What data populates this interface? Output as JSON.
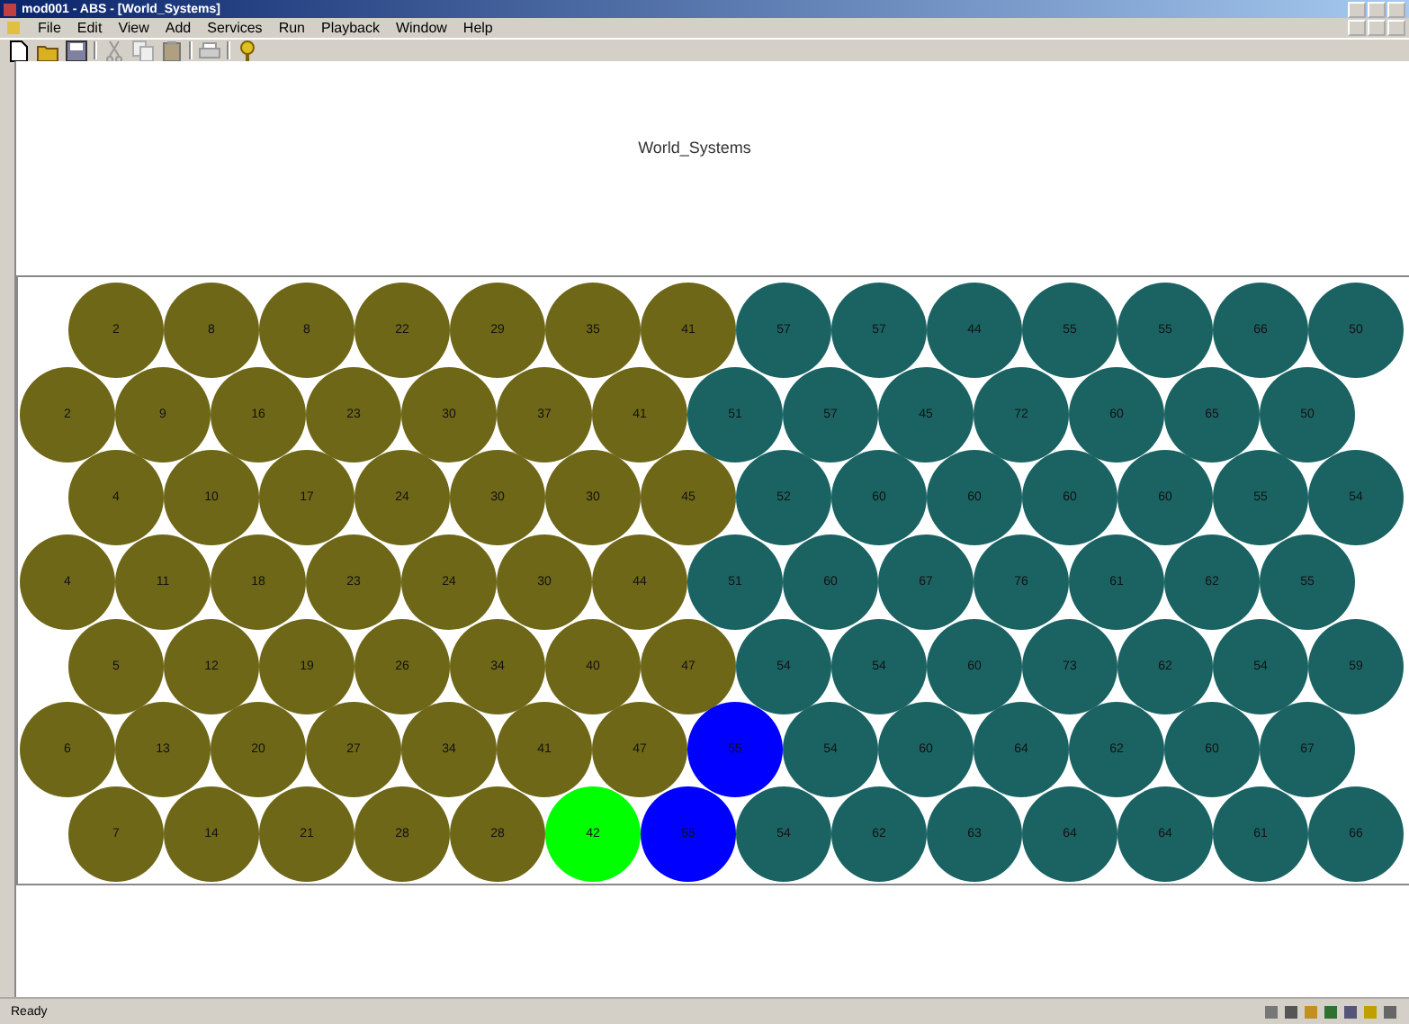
{
  "window": {
    "title": "mod001 - ABS - [World_Systems]"
  },
  "menu": [
    "File",
    "Edit",
    "View",
    "Add",
    "Services",
    "Run",
    "Playback",
    "Window",
    "Help"
  ],
  "canvas": {
    "title": "World_Systems",
    "rows": [
      [
        {
          "label": "2",
          "color": "#6e6718"
        },
        {
          "label": "8",
          "color": "#6e6718"
        },
        {
          "label": "8",
          "color": "#6e6718"
        },
        {
          "label": "22",
          "color": "#6e6718"
        },
        {
          "label": "29",
          "color": "#6e6718"
        },
        {
          "label": "35",
          "color": "#6e6718"
        },
        {
          "label": "41",
          "color": "#6e6718"
        },
        {
          "label": "57",
          "color": "#1b6363"
        },
        {
          "label": "57",
          "color": "#1b6363"
        },
        {
          "label": "44",
          "color": "#1b6363"
        },
        {
          "label": "55",
          "color": "#1b6363"
        },
        {
          "label": "55",
          "color": "#1b6363"
        },
        {
          "label": "66",
          "color": "#1b6363"
        },
        {
          "label": "50",
          "color": "#1b6363"
        }
      ],
      [
        {
          "label": "2",
          "color": "#6e6718"
        },
        {
          "label": "9",
          "color": "#6e6718"
        },
        {
          "label": "16",
          "color": "#6e6718"
        },
        {
          "label": "23",
          "color": "#6e6718"
        },
        {
          "label": "30",
          "color": "#6e6718"
        },
        {
          "label": "37",
          "color": "#6e6718"
        },
        {
          "label": "41",
          "color": "#6e6718"
        },
        {
          "label": "51",
          "color": "#1b6363"
        },
        {
          "label": "57",
          "color": "#1b6363"
        },
        {
          "label": "45",
          "color": "#1b6363"
        },
        {
          "label": "72",
          "color": "#1b6363"
        },
        {
          "label": "60",
          "color": "#1b6363"
        },
        {
          "label": "65",
          "color": "#1b6363"
        },
        {
          "label": "50",
          "color": "#1b6363"
        }
      ],
      [
        {
          "label": "4",
          "color": "#6e6718"
        },
        {
          "label": "10",
          "color": "#6e6718"
        },
        {
          "label": "17",
          "color": "#6e6718"
        },
        {
          "label": "24",
          "color": "#6e6718"
        },
        {
          "label": "30",
          "color": "#6e6718"
        },
        {
          "label": "30",
          "color": "#6e6718"
        },
        {
          "label": "45",
          "color": "#6e6718"
        },
        {
          "label": "52",
          "color": "#1b6363"
        },
        {
          "label": "60",
          "color": "#1b6363"
        },
        {
          "label": "60",
          "color": "#1b6363"
        },
        {
          "label": "60",
          "color": "#1b6363"
        },
        {
          "label": "60",
          "color": "#1b6363"
        },
        {
          "label": "55",
          "color": "#1b6363"
        },
        {
          "label": "54",
          "color": "#1b6363"
        }
      ],
      [
        {
          "label": "4",
          "color": "#6e6718"
        },
        {
          "label": "11",
          "color": "#6e6718"
        },
        {
          "label": "18",
          "color": "#6e6718"
        },
        {
          "label": "23",
          "color": "#6e6718"
        },
        {
          "label": "24",
          "color": "#6e6718"
        },
        {
          "label": "30",
          "color": "#6e6718"
        },
        {
          "label": "44",
          "color": "#6e6718"
        },
        {
          "label": "51",
          "color": "#1b6363"
        },
        {
          "label": "60",
          "color": "#1b6363"
        },
        {
          "label": "67",
          "color": "#1b6363"
        },
        {
          "label": "76",
          "color": "#1b6363"
        },
        {
          "label": "61",
          "color": "#1b6363"
        },
        {
          "label": "62",
          "color": "#1b6363"
        },
        {
          "label": "55",
          "color": "#1b6363"
        }
      ],
      [
        {
          "label": "5",
          "color": "#6e6718"
        },
        {
          "label": "12",
          "color": "#6e6718"
        },
        {
          "label": "19",
          "color": "#6e6718"
        },
        {
          "label": "26",
          "color": "#6e6718"
        },
        {
          "label": "34",
          "color": "#6e6718"
        },
        {
          "label": "40",
          "color": "#6e6718"
        },
        {
          "label": "47",
          "color": "#6e6718"
        },
        {
          "label": "54",
          "color": "#1b6363"
        },
        {
          "label": "54",
          "color": "#1b6363"
        },
        {
          "label": "60",
          "color": "#1b6363"
        },
        {
          "label": "73",
          "color": "#1b6363"
        },
        {
          "label": "62",
          "color": "#1b6363"
        },
        {
          "label": "54",
          "color": "#1b6363"
        },
        {
          "label": "59",
          "color": "#1b6363"
        }
      ],
      [
        {
          "label": "6",
          "color": "#6e6718"
        },
        {
          "label": "13",
          "color": "#6e6718"
        },
        {
          "label": "20",
          "color": "#6e6718"
        },
        {
          "label": "27",
          "color": "#6e6718"
        },
        {
          "label": "34",
          "color": "#6e6718"
        },
        {
          "label": "41",
          "color": "#6e6718"
        },
        {
          "label": "47",
          "color": "#6e6718"
        },
        {
          "label": "55",
          "color": "#0000ff"
        },
        {
          "label": "54",
          "color": "#1b6363"
        },
        {
          "label": "60",
          "color": "#1b6363"
        },
        {
          "label": "64",
          "color": "#1b6363"
        },
        {
          "label": "62",
          "color": "#1b6363"
        },
        {
          "label": "60",
          "color": "#1b6363"
        },
        {
          "label": "67",
          "color": "#1b6363"
        }
      ],
      [
        {
          "label": "7",
          "color": "#6e6718"
        },
        {
          "label": "14",
          "color": "#6e6718"
        },
        {
          "label": "21",
          "color": "#6e6718"
        },
        {
          "label": "28",
          "color": "#6e6718"
        },
        {
          "label": "28",
          "color": "#6e6718"
        },
        {
          "label": "42",
          "color": "#00ff00"
        },
        {
          "label": "55",
          "color": "#0000ff"
        },
        {
          "label": "54",
          "color": "#1b6363"
        },
        {
          "label": "62",
          "color": "#1b6363"
        },
        {
          "label": "63",
          "color": "#1b6363"
        },
        {
          "label": "64",
          "color": "#1b6363"
        },
        {
          "label": "64",
          "color": "#1b6363"
        },
        {
          "label": "61",
          "color": "#1b6363"
        },
        {
          "label": "66",
          "color": "#1b6363"
        }
      ]
    ]
  },
  "status_bar": {
    "text": "Ready"
  }
}
